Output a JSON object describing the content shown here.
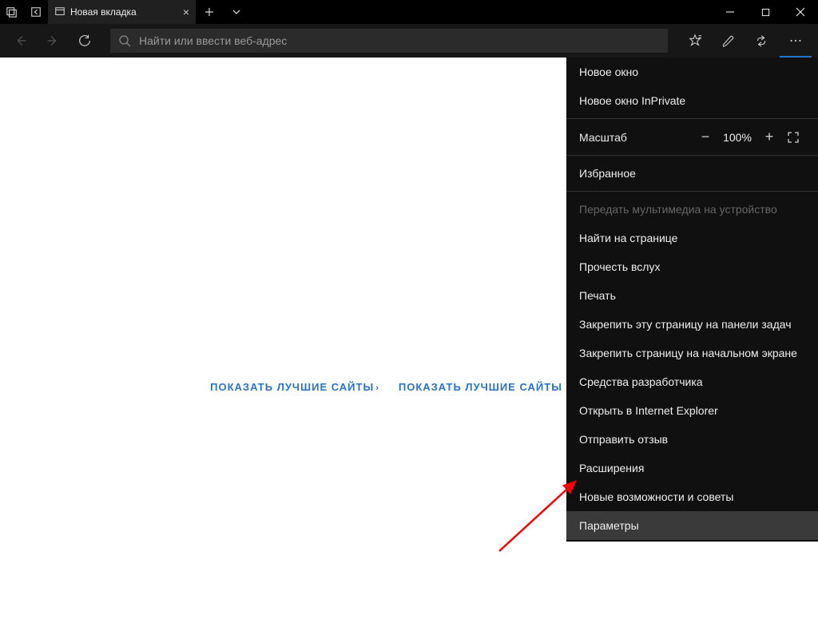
{
  "tab": {
    "title": "Новая вкладка"
  },
  "address": {
    "placeholder": "Найти или ввести веб-адрес"
  },
  "content": {
    "link1": "ПОКАЗАТЬ ЛУЧШИЕ САЙТЫ",
    "link2": "ПОКАЗАТЬ ЛУЧШИЕ САЙТЫ И МОЮ"
  },
  "menu": {
    "newWindow": "Новое окно",
    "newInPrivate": "Новое окно InPrivate",
    "zoomLabel": "Масштаб",
    "zoomValue": "100%",
    "favorites": "Избранное",
    "castMedia": "Передать мультимедиа на устройство",
    "findOnPage": "Найти на странице",
    "readAloud": "Прочесть вслух",
    "print": "Печать",
    "pinTaskbar": "Закрепить эту страницу на панели задач",
    "pinStart": "Закрепить страницу на начальном экране",
    "devTools": "Средства разработчика",
    "openIE": "Открыть в Internet Explorer",
    "feedback": "Отправить отзыв",
    "extensions": "Расширения",
    "whatsNew": "Новые возможности и советы",
    "settings": "Параметры"
  }
}
